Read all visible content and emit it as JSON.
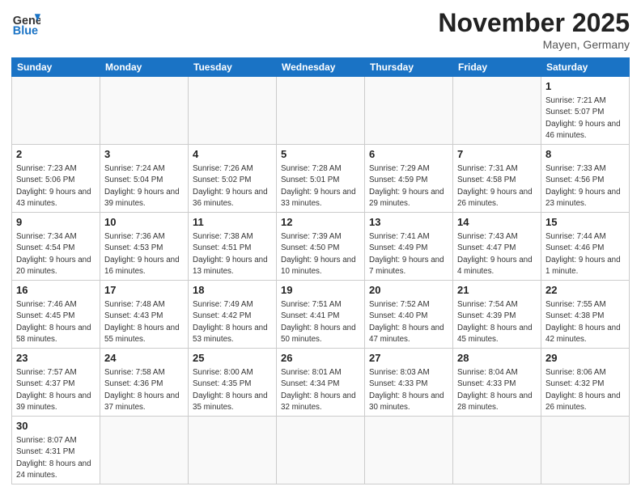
{
  "header": {
    "logo_general": "General",
    "logo_blue": "Blue",
    "month_title": "November 2025",
    "location": "Mayen, Germany"
  },
  "weekdays": [
    "Sunday",
    "Monday",
    "Tuesday",
    "Wednesday",
    "Thursday",
    "Friday",
    "Saturday"
  ],
  "weeks": [
    [
      {
        "day": null,
        "info": null
      },
      {
        "day": null,
        "info": null
      },
      {
        "day": null,
        "info": null
      },
      {
        "day": null,
        "info": null
      },
      {
        "day": null,
        "info": null
      },
      {
        "day": null,
        "info": null
      },
      {
        "day": "1",
        "info": "Sunrise: 7:21 AM\nSunset: 5:07 PM\nDaylight: 9 hours\nand 46 minutes."
      }
    ],
    [
      {
        "day": "2",
        "info": "Sunrise: 7:23 AM\nSunset: 5:06 PM\nDaylight: 9 hours\nand 43 minutes."
      },
      {
        "day": "3",
        "info": "Sunrise: 7:24 AM\nSunset: 5:04 PM\nDaylight: 9 hours\nand 39 minutes."
      },
      {
        "day": "4",
        "info": "Sunrise: 7:26 AM\nSunset: 5:02 PM\nDaylight: 9 hours\nand 36 minutes."
      },
      {
        "day": "5",
        "info": "Sunrise: 7:28 AM\nSunset: 5:01 PM\nDaylight: 9 hours\nand 33 minutes."
      },
      {
        "day": "6",
        "info": "Sunrise: 7:29 AM\nSunset: 4:59 PM\nDaylight: 9 hours\nand 29 minutes."
      },
      {
        "day": "7",
        "info": "Sunrise: 7:31 AM\nSunset: 4:58 PM\nDaylight: 9 hours\nand 26 minutes."
      },
      {
        "day": "8",
        "info": "Sunrise: 7:33 AM\nSunset: 4:56 PM\nDaylight: 9 hours\nand 23 minutes."
      }
    ],
    [
      {
        "day": "9",
        "info": "Sunrise: 7:34 AM\nSunset: 4:54 PM\nDaylight: 9 hours\nand 20 minutes."
      },
      {
        "day": "10",
        "info": "Sunrise: 7:36 AM\nSunset: 4:53 PM\nDaylight: 9 hours\nand 16 minutes."
      },
      {
        "day": "11",
        "info": "Sunrise: 7:38 AM\nSunset: 4:51 PM\nDaylight: 9 hours\nand 13 minutes."
      },
      {
        "day": "12",
        "info": "Sunrise: 7:39 AM\nSunset: 4:50 PM\nDaylight: 9 hours\nand 10 minutes."
      },
      {
        "day": "13",
        "info": "Sunrise: 7:41 AM\nSunset: 4:49 PM\nDaylight: 9 hours\nand 7 minutes."
      },
      {
        "day": "14",
        "info": "Sunrise: 7:43 AM\nSunset: 4:47 PM\nDaylight: 9 hours\nand 4 minutes."
      },
      {
        "day": "15",
        "info": "Sunrise: 7:44 AM\nSunset: 4:46 PM\nDaylight: 9 hours\nand 1 minute."
      }
    ],
    [
      {
        "day": "16",
        "info": "Sunrise: 7:46 AM\nSunset: 4:45 PM\nDaylight: 8 hours\nand 58 minutes."
      },
      {
        "day": "17",
        "info": "Sunrise: 7:48 AM\nSunset: 4:43 PM\nDaylight: 8 hours\nand 55 minutes."
      },
      {
        "day": "18",
        "info": "Sunrise: 7:49 AM\nSunset: 4:42 PM\nDaylight: 8 hours\nand 53 minutes."
      },
      {
        "day": "19",
        "info": "Sunrise: 7:51 AM\nSunset: 4:41 PM\nDaylight: 8 hours\nand 50 minutes."
      },
      {
        "day": "20",
        "info": "Sunrise: 7:52 AM\nSunset: 4:40 PM\nDaylight: 8 hours\nand 47 minutes."
      },
      {
        "day": "21",
        "info": "Sunrise: 7:54 AM\nSunset: 4:39 PM\nDaylight: 8 hours\nand 45 minutes."
      },
      {
        "day": "22",
        "info": "Sunrise: 7:55 AM\nSunset: 4:38 PM\nDaylight: 8 hours\nand 42 minutes."
      }
    ],
    [
      {
        "day": "23",
        "info": "Sunrise: 7:57 AM\nSunset: 4:37 PM\nDaylight: 8 hours\nand 39 minutes."
      },
      {
        "day": "24",
        "info": "Sunrise: 7:58 AM\nSunset: 4:36 PM\nDaylight: 8 hours\nand 37 minutes."
      },
      {
        "day": "25",
        "info": "Sunrise: 8:00 AM\nSunset: 4:35 PM\nDaylight: 8 hours\nand 35 minutes."
      },
      {
        "day": "26",
        "info": "Sunrise: 8:01 AM\nSunset: 4:34 PM\nDaylight: 8 hours\nand 32 minutes."
      },
      {
        "day": "27",
        "info": "Sunrise: 8:03 AM\nSunset: 4:33 PM\nDaylight: 8 hours\nand 30 minutes."
      },
      {
        "day": "28",
        "info": "Sunrise: 8:04 AM\nSunset: 4:33 PM\nDaylight: 8 hours\nand 28 minutes."
      },
      {
        "day": "29",
        "info": "Sunrise: 8:06 AM\nSunset: 4:32 PM\nDaylight: 8 hours\nand 26 minutes."
      }
    ],
    [
      {
        "day": "30",
        "info": "Sunrise: 8:07 AM\nSunset: 4:31 PM\nDaylight: 8 hours\nand 24 minutes."
      },
      {
        "day": null,
        "info": null
      },
      {
        "day": null,
        "info": null
      },
      {
        "day": null,
        "info": null
      },
      {
        "day": null,
        "info": null
      },
      {
        "day": null,
        "info": null
      },
      {
        "day": null,
        "info": null
      }
    ]
  ]
}
